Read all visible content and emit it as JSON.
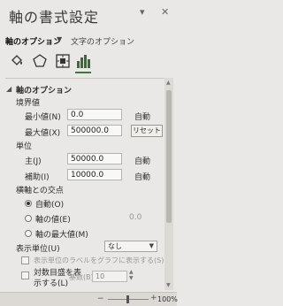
{
  "pane": {
    "title": "軸の書式設定",
    "dropdown_icon": "chevron-down-icon",
    "close_icon": "close-icon"
  },
  "tabs": {
    "active": "軸のオプション",
    "inactive": "文字のオプション"
  },
  "icons": [
    "fill-line-icon",
    "effects-pentagon-icon",
    "size-properties-icon",
    "axis-options-bar-chart-icon"
  ],
  "section": {
    "title": "軸のオプション"
  },
  "bounds": {
    "heading": "境界値",
    "min_label": "最小値(N)",
    "min_value": "0.0",
    "min_auto": "自動",
    "max_label": "最大値(X)",
    "max_value": "500000.0",
    "max_reset": "リセット"
  },
  "units": {
    "heading": "単位",
    "major_label": "主(J)",
    "major_value": "50000.0",
    "major_auto": "自動",
    "minor_label": "補助(I)",
    "minor_value": "10000.0",
    "minor_auto": "自動"
  },
  "crosses": {
    "heading": "横軸との交点",
    "auto_label": "自動(O)",
    "value_label": "軸の値(E)",
    "value_field": "0.0",
    "max_label": "軸の最大値(M)"
  },
  "display_units": {
    "label": "表示単位(U)",
    "value": "なし",
    "show_label_checkbox": "表示単位のラベルをグラフに表示する(S)"
  },
  "log_scale": {
    "label": "対数目盛を表示する(L)",
    "base_label": "基数(B)",
    "base_value": "10"
  },
  "status": {
    "zoom": "100%"
  },
  "colors": {
    "accent": "#3a7a3a",
    "background": "#eae8e6"
  }
}
